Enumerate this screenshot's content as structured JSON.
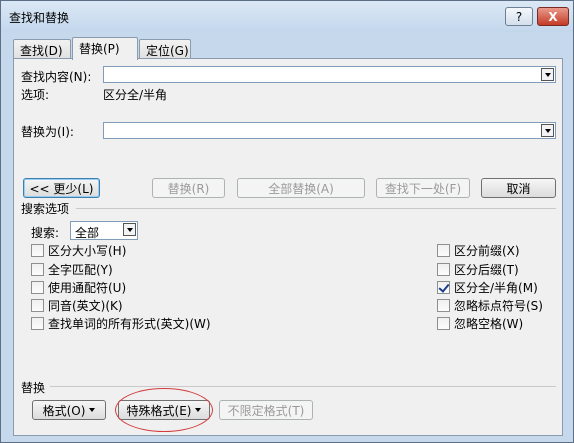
{
  "window": {
    "title": "查找和替换",
    "help_label": "?",
    "close_label": "X"
  },
  "tabs": [
    {
      "label": "查找(D)",
      "active": false
    },
    {
      "label": "替换(P)",
      "active": true
    },
    {
      "label": "定位(G)",
      "active": false
    }
  ],
  "find": {
    "label": "查找内容(N):",
    "value": "",
    "options_label": "选项:",
    "options_value": "区分全/半角"
  },
  "replace": {
    "label": "替换为(I):",
    "value": ""
  },
  "buttons": {
    "less": "<< 更少(L)",
    "replace": "替换(R)",
    "replace_all": "全部替换(A)",
    "find_next": "查找下一处(F)",
    "cancel": "取消"
  },
  "search_options": {
    "section_title": "搜索选项",
    "search_label": "搜索:",
    "search_value": "全部",
    "left": [
      {
        "label": "区分大小写(H)",
        "checked": false
      },
      {
        "label": "全字匹配(Y)",
        "checked": false
      },
      {
        "label": "使用通配符(U)",
        "checked": false
      },
      {
        "label": "同音(英文)(K)",
        "checked": false
      },
      {
        "label": "查找单词的所有形式(英文)(W)",
        "checked": false
      }
    ],
    "right": [
      {
        "label": "区分前缀(X)",
        "checked": false
      },
      {
        "label": "区分后缀(T)",
        "checked": false
      },
      {
        "label": "区分全/半角(M)",
        "checked": true
      },
      {
        "label": "忽略标点符号(S)",
        "checked": false
      },
      {
        "label": "忽略空格(W)",
        "checked": false
      }
    ]
  },
  "replace_section": {
    "title": "替换",
    "format": "格式(O)",
    "special": "特殊格式(E)",
    "no_format": "不限定格式(T)"
  },
  "annotation_color": "#d23c3c"
}
